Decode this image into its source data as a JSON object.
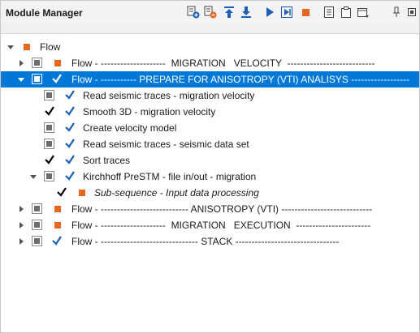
{
  "panel": {
    "title": "Module Manager"
  },
  "toolbar": [
    {
      "name": "add-module-icon"
    },
    {
      "name": "remove-module-icon"
    },
    {
      "name": "move-up-icon"
    },
    {
      "name": "move-down-icon"
    },
    {
      "name": "run-icon"
    },
    {
      "name": "run-step-icon"
    },
    {
      "name": "stop-icon"
    },
    {
      "name": "report-icon"
    },
    {
      "name": "clipboard-icon"
    },
    {
      "name": "window-options-icon"
    },
    {
      "name": "pin-icon"
    },
    {
      "name": "maximize-icon"
    }
  ],
  "tree": {
    "root": "Flow",
    "items": [
      {
        "label": "Flow - --------------------  MIGRATION   VELOCITY  ---------------------------"
      },
      {
        "label": "Flow - ----------- PREPARE FOR ANISOTROPY (VTI) ANALISYS ------------------"
      },
      {
        "label": "Read seismic traces - migration velocity"
      },
      {
        "label": "Smooth 3D - migration velocity"
      },
      {
        "label": "Create velocity model"
      },
      {
        "label": "Read seismic traces - seismic data set"
      },
      {
        "label": "Sort traces"
      },
      {
        "label": "Kirchhoff PreSTM - file in/out - migration"
      },
      {
        "label": "Sub-sequence - Input data processing"
      },
      {
        "label": "Flow - --------------------------- ANISOTROPY (VTI) ----------------------------"
      },
      {
        "label": "Flow - --------------------  MIGRATION   EXECUTION  -----------------------"
      },
      {
        "label": "Flow - ------------------------------ STACK --------------------------------"
      }
    ]
  },
  "colors": {
    "selection": "#0078d7",
    "check": "#1a5fb4",
    "disabled_marker": "#e8661f"
  }
}
